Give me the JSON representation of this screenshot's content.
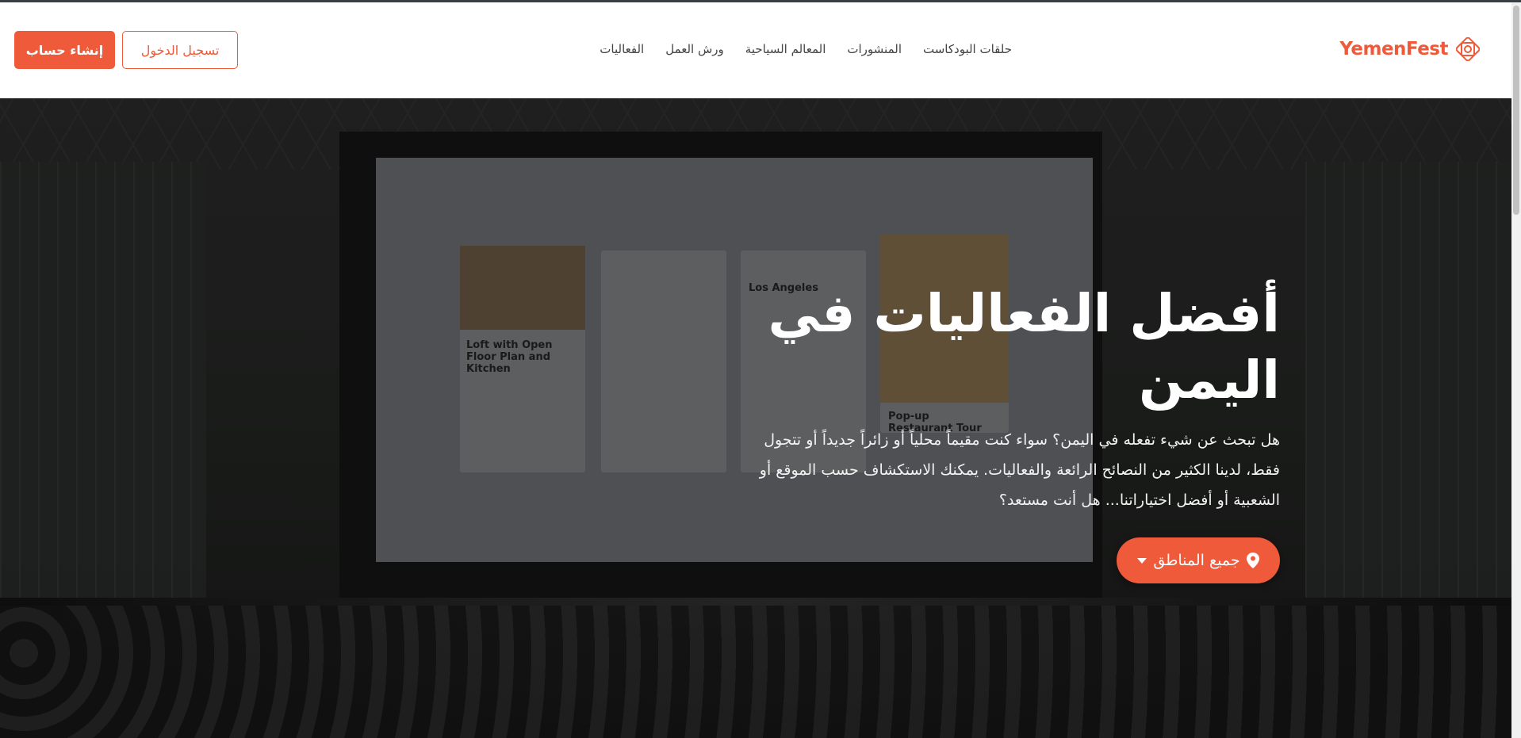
{
  "header": {
    "brand_name": "YemenFest",
    "nav": [
      {
        "label": "الفعاليات"
      },
      {
        "label": "ورش العمل"
      },
      {
        "label": "المعالم السياحية"
      },
      {
        "label": "المنشورات"
      },
      {
        "label": "حلقات البودكاست"
      }
    ],
    "login_label": "تسجيل الدخول",
    "register_label": "إنشاء حساب"
  },
  "hero": {
    "title": "أفضل الفعاليات في اليمن",
    "description": "هل تبحث عن شيء تفعله في اليمن؟ سواء كنت مقيماً محلياً أو زائراً جديداً أو تتجول فقط، لدينا الكثير من النصائح الرائعة والفعاليات. يمكنك الاستكشاف حسب الموقع أو الشعبية أو أفضل اختياراتنا... هل أنت مستعد؟",
    "region_button_label": "جميع المناطق",
    "background_screen_text": {
      "card1_title": "Loft with Open Floor Plan and Kitchen",
      "card3_title": "Los Angeles",
      "card4_title": "Pop-up Restaurant Tour"
    }
  },
  "colors": {
    "accent": "#ee5a3a",
    "header_bg": "#ffffff",
    "nav_text": "#444444"
  },
  "icons": {
    "brand": "ornament-logo-icon",
    "region": "map-pin-icon",
    "dropdown": "caret-down-icon"
  }
}
